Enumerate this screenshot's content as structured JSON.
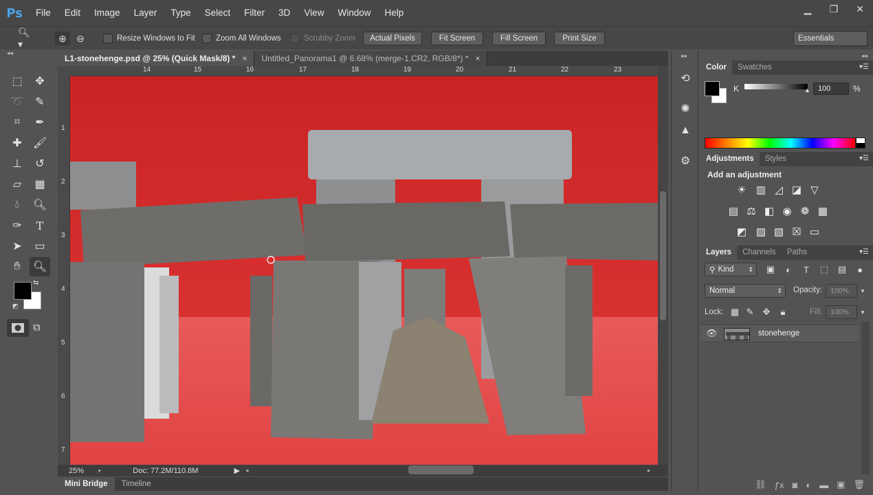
{
  "app": {
    "logo": "Ps",
    "menu": [
      "File",
      "Edit",
      "Image",
      "Layer",
      "Type",
      "Select",
      "Filter",
      "3D",
      "View",
      "Window",
      "Help"
    ],
    "window_controls": [
      "minimize-icon",
      "restore-icon",
      "close-icon"
    ]
  },
  "options": {
    "resize_windows": "Resize Windows to Fit",
    "zoom_all": "Zoom All Windows",
    "scrubby_zoom": "Scrubby Zoom",
    "actual_pixels": "Actual Pixels",
    "fit_screen": "Fit Screen",
    "fill_screen": "Fill Screen",
    "print_size": "Print Size",
    "workspace": "Essentials"
  },
  "document": {
    "tabs": [
      {
        "label": "L1-stonehenge.psd @ 25% (Quick Mask/8) *",
        "close": "×"
      },
      {
        "label": "Untitled_Panorama1 @ 6.68% (merge-1.CR2, RGB/8*) *",
        "close": "×"
      }
    ],
    "ruler_top": [
      "14",
      "15",
      "16",
      "17",
      "18",
      "19",
      "20",
      "21",
      "22",
      "23"
    ],
    "ruler_left": [
      "1",
      "2",
      "3",
      "4",
      "5",
      "6",
      "7"
    ],
    "zoom": "25%",
    "doc_size": "Doc: 77.2M/110.8M",
    "bottom_tabs": [
      "Mini Bridge",
      "Timeline"
    ]
  },
  "color_panel": {
    "tabs": [
      "Color",
      "Swatches"
    ],
    "channel": "K",
    "value": "100",
    "unit": "%",
    "slider_level": 1.0
  },
  "adjustments_panel": {
    "tabs": [
      "Adjustments",
      "Styles"
    ],
    "title": "Add an adjustment"
  },
  "layers_panel": {
    "tabs": [
      "Layers",
      "Channels",
      "Paths"
    ],
    "filter_kind": "Kind",
    "blend_mode": "Normal",
    "opacity_label": "Opacity:",
    "opacity_value": "100%",
    "lock_label": "Lock:",
    "fill_label": "Fill:",
    "fill_value": "100%",
    "layers": [
      {
        "name": "stonehenge",
        "thumb_text": "stonehenge"
      }
    ]
  },
  "colors": {
    "quick_mask": "#cf2d2d",
    "foreground": "#000000",
    "background": "#ffffff"
  }
}
